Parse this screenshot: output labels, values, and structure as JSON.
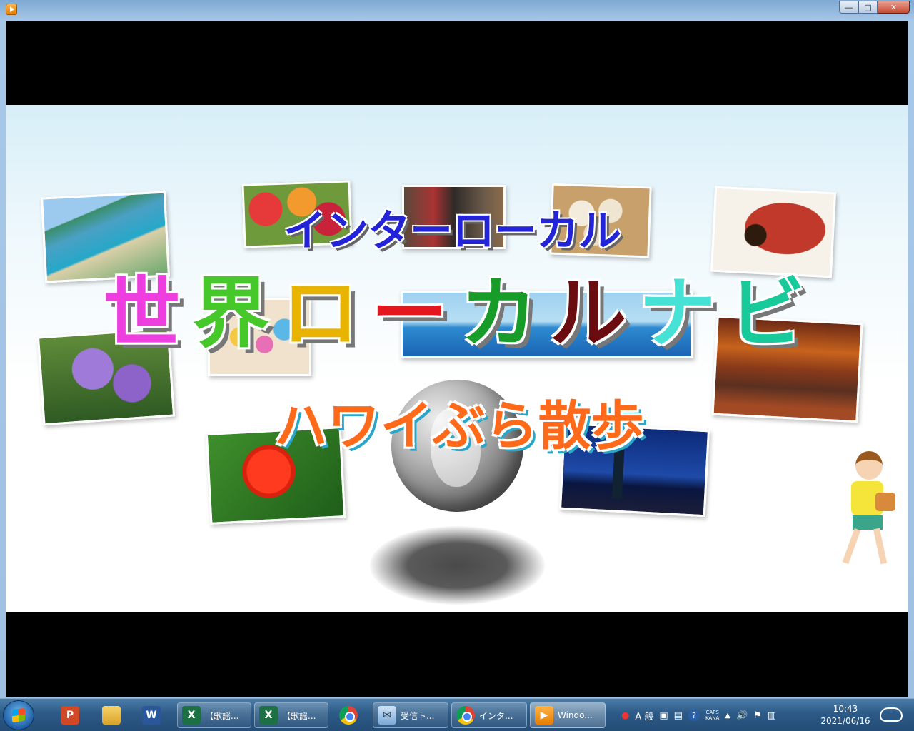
{
  "video": {
    "title_top": "インターローカル",
    "title_main": [
      {
        "char": "世",
        "color": "#ef3ee0"
      },
      {
        "char": "界",
        "color": "#46c82a"
      },
      {
        "char": "ロ",
        "color": "#e8b400"
      },
      {
        "char": "ー",
        "color": "#e3171d"
      },
      {
        "char": "カ",
        "color": "#179c2a"
      },
      {
        "char": "ル",
        "color": "#6a0c10"
      },
      {
        "char": "ナ",
        "color": "#46e2d6"
      },
      {
        "char": "ビ",
        "color": "#18c99a"
      }
    ],
    "subtitle": "ハワイぶら散歩"
  },
  "taskbar": {
    "items": [
      {
        "label": "",
        "icon": "P"
      },
      {
        "label": "",
        "icon": ""
      },
      {
        "label": "",
        "icon": "W"
      },
      {
        "label": "【歌謡...",
        "icon": "X"
      },
      {
        "label": "【歌謡...",
        "icon": "X"
      },
      {
        "label": "",
        "icon": ""
      },
      {
        "label": "受信ト...",
        "icon": ""
      },
      {
        "label": "インタ...",
        "icon": ""
      },
      {
        "label": "Windo...",
        "icon": ""
      }
    ],
    "tray": {
      "ime": "A 般",
      "caps": "CAPS",
      "kana": "KANA",
      "help": "?"
    },
    "clock": {
      "time": "10:43",
      "date": "2021/06/16"
    }
  }
}
